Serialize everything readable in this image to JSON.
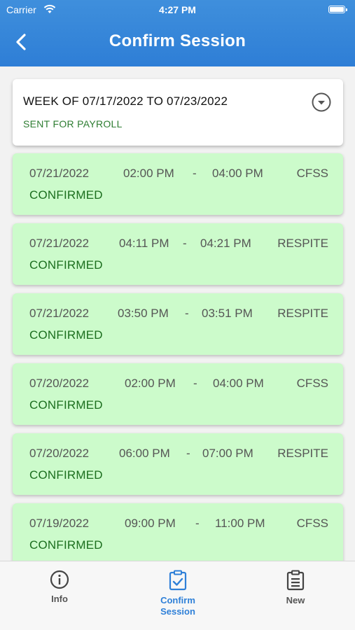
{
  "status_bar": {
    "carrier": "Carrier",
    "time": "4:27 PM"
  },
  "header": {
    "title": "Confirm Session"
  },
  "week": {
    "title": "WEEK OF 07/17/2022 TO 07/23/2022",
    "status": "SENT FOR PAYROLL"
  },
  "sessions": [
    {
      "date": "07/21/2022",
      "start": "02:00 PM",
      "sep": "-",
      "end": "04:00 PM",
      "type": "CFSS",
      "status": "CONFIRMED"
    },
    {
      "date": "07/21/2022",
      "start": "04:11 PM",
      "sep": "-",
      "end": "04:21 PM",
      "type": "RESPITE",
      "status": "CONFIRMED"
    },
    {
      "date": "07/21/2022",
      "start": "03:50 PM",
      "sep": "-",
      "end": "03:51 PM",
      "type": "RESPITE",
      "status": "CONFIRMED"
    },
    {
      "date": "07/20/2022",
      "start": "02:00 PM",
      "sep": "-",
      "end": "04:00 PM",
      "type": "CFSS",
      "status": "CONFIRMED"
    },
    {
      "date": "07/20/2022",
      "start": "06:00 PM",
      "sep": "-",
      "end": "07:00 PM",
      "type": "RESPITE",
      "status": "CONFIRMED"
    },
    {
      "date": "07/19/2022",
      "start": "09:00 PM",
      "sep": "-",
      "end": "11:00 PM",
      "type": "CFSS",
      "status": "CONFIRMED"
    }
  ],
  "tabs": [
    {
      "label": "Info",
      "icon": "info-icon"
    },
    {
      "label": "Confirm\nSession",
      "icon": "clipboard-check-icon",
      "active": true
    },
    {
      "label": "New",
      "icon": "clipboard-list-icon"
    }
  ],
  "colors": {
    "header": "#2e7ed6",
    "session_bg": "#ccfbcb",
    "confirmed": "#1b6e1e",
    "tab_active": "#2f80d8"
  }
}
